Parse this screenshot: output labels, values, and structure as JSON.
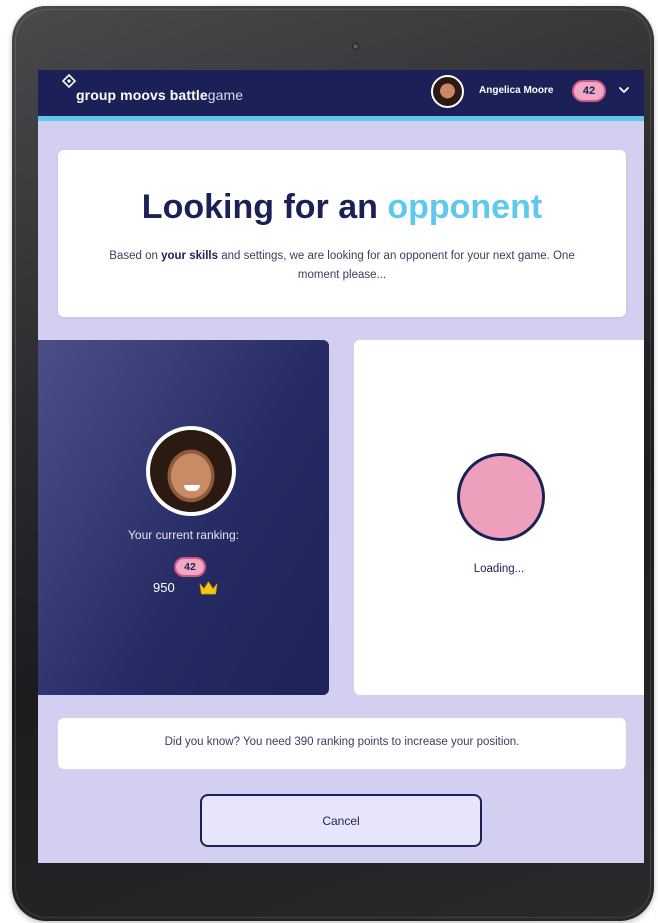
{
  "header": {
    "brand": {
      "part1": "group moovs",
      "part2_bold": "battle",
      "part2_light": "game"
    },
    "user": {
      "name": "Angelica Moore",
      "rank_badge": "42"
    },
    "logo_icon": "diamond-logo-icon",
    "menu_icon": "chevron-down-icon"
  },
  "search_card": {
    "title_main": "Looking for an",
    "title_accent": "opponent",
    "subtitle_before": "Based on",
    "subtitle_bold": "your skills",
    "subtitle_after": "and settings, we are looking for an opponent for your next game. One moment please..."
  },
  "player": {
    "ranking_label": "Your current ranking:",
    "rank_badge": "42",
    "points": "950",
    "points_icon": "crown-icon"
  },
  "opponent": {
    "status": "Loading..."
  },
  "tip": {
    "text": "Did you know? You need 390 ranking points to increase your position."
  },
  "actions": {
    "cancel_label": "Cancel"
  },
  "colors": {
    "navy": "#1b2157",
    "accent_blue": "#5fc8ee",
    "badge_pink": "#f2a7c3",
    "background_lavender": "#d2cff0",
    "cancel_bg": "#e7e5fb",
    "crown_gold": "#f5c518"
  }
}
